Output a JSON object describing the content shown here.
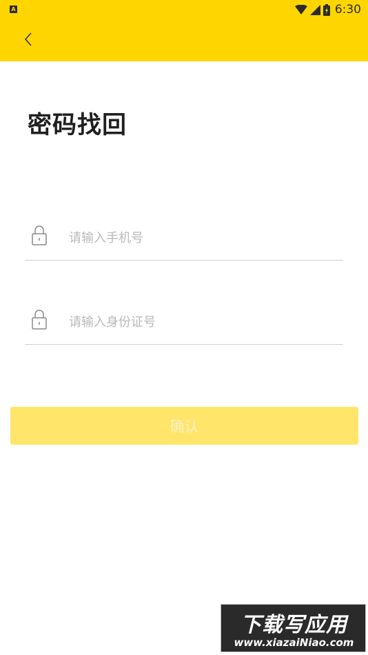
{
  "status_bar": {
    "app_icon_letter": "A",
    "time": "6:30"
  },
  "page": {
    "title": "密码找回"
  },
  "form": {
    "phone_placeholder": "请输入手机号",
    "id_placeholder": "请输入身份证号",
    "phone_value": "",
    "id_value": ""
  },
  "actions": {
    "confirm_label": "确认"
  },
  "watermark": {
    "title": "下载写应用",
    "url": "www.xiazaiNiao.com"
  },
  "colors": {
    "header": "#FFD500",
    "button": "#FFE66A"
  }
}
